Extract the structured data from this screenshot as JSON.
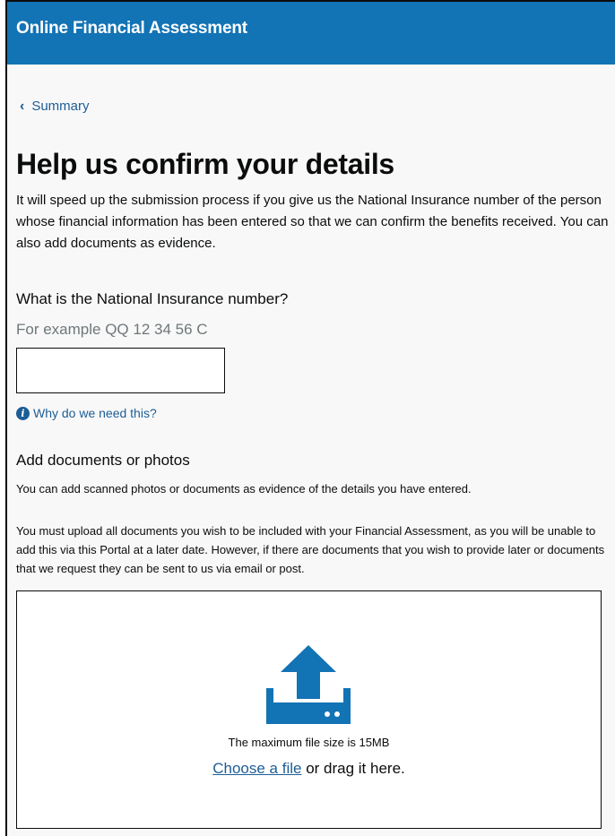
{
  "header": {
    "title": "Online Financial Assessment"
  },
  "breadcrumb": {
    "back_label": "Summary"
  },
  "page": {
    "heading": "Help us confirm your details",
    "intro": "It will speed up the submission process if you give us the National Insurance number of the person whose financial information has been entered so that we can confirm the benefits received. You can also add documents as evidence."
  },
  "ni_number": {
    "label": "What is the National Insurance number?",
    "hint": "For example QQ 12 34 56 C",
    "value": "",
    "placeholder": "",
    "why_link": "Why do we need this?",
    "icon": "info-icon"
  },
  "documents": {
    "label": "Add documents or photos",
    "hint": "You can add scanned photos or documents as evidence of the details you have entered.",
    "warning": "You must upload all documents you wish to be included with your Financial Assessment, as you will be unable to add this via this Portal at a later date. However, if there are documents that you wish to provide later or documents that we request they can be sent to us via email or post.",
    "dropzone": {
      "icon": "upload-icon",
      "max_size": "The maximum file size is 15MB",
      "choose_link": "Choose a file",
      "drag_text": " or drag it here."
    }
  },
  "colors": {
    "header_bg": "#1273b5",
    "link": "#1d5d96",
    "hint_text": "#6f777b",
    "upload_icon": "#1273b5"
  }
}
